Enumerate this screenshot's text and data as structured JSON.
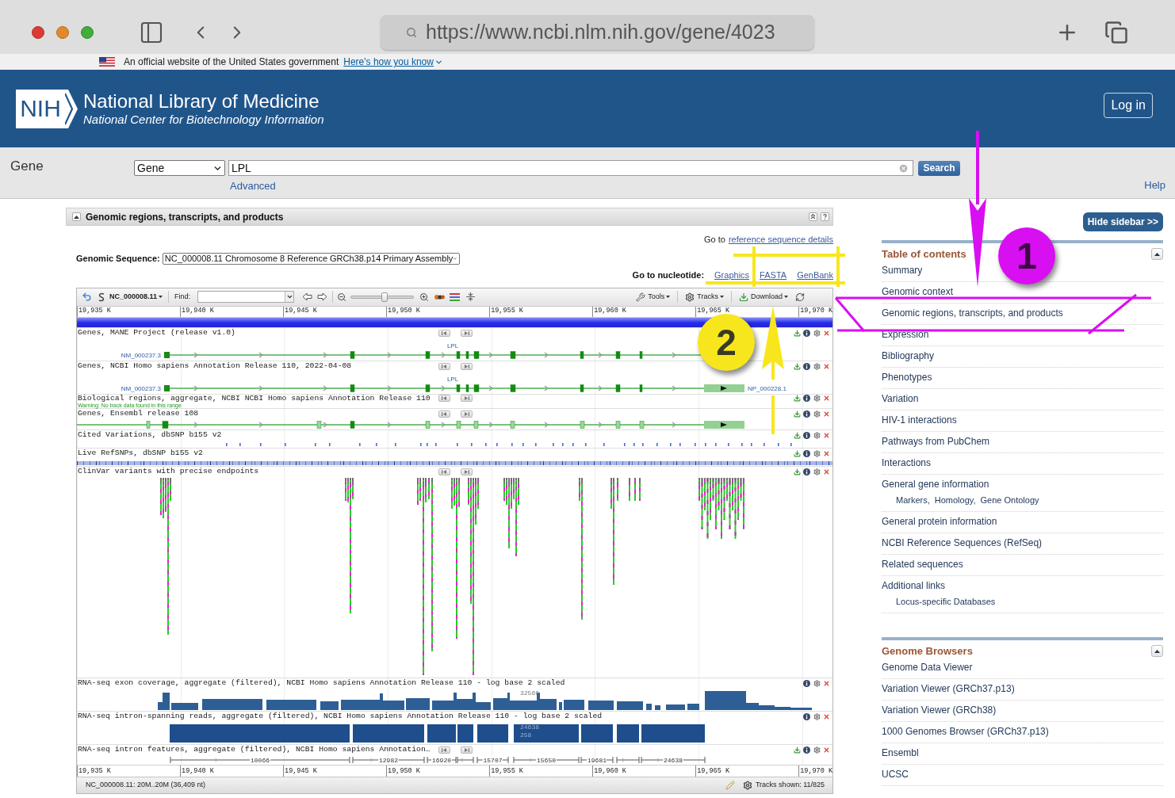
{
  "browser": {
    "url": "https://www.ncbi.nlm.nih.gov/gene/4023"
  },
  "gov_banner": {
    "text": "An official website of the United States government",
    "link": "Here's how you know"
  },
  "header": {
    "logo": "NIH",
    "title": "National Library of Medicine",
    "subtitle": "National Center for Biotechnology Information",
    "login_button": "Log in"
  },
  "search_bar": {
    "database_label": "Gene",
    "database": "Gene",
    "query": "LPL",
    "search_button": "Search",
    "advanced_link": "Advanced",
    "help_link": "Help"
  },
  "section": {
    "title": "Genomic regions, transcripts, and products",
    "expanded": true,
    "reference_prefix": "Go to",
    "reference_link": "reference sequence details",
    "sequence_label": "Genomic Sequence:",
    "sequence": "NC_000008.11 Chromosome 8 Reference GRCh38.p14 Primary Assembly",
    "nucleotide_label": "Go to nucleotide:",
    "nucleotide_links": [
      "Graphics",
      "FASTA",
      "GenBank"
    ],
    "viewer": {
      "toolbar": {
        "sequence": "NC_000008.11",
        "find_label": "Find:",
        "zoom": {
          "level": 0.54
        },
        "menus": [
          {
            "kind": "tools",
            "label": "Tools"
          },
          {
            "kind": "tracks",
            "label": "Tracks"
          },
          {
            "kind": "download",
            "label": "Download"
          }
        ]
      },
      "ruler_top": [
        "19,935 K",
        "19,940 K",
        "19,945 K",
        "19,950 K",
        "19,955 K",
        "19,960 K",
        "19,965 K",
        "19,970 K"
      ],
      "tracks": [
        {
          "kind": "gene",
          "title": "Genes, MANE Project (release v1.0)",
          "gene": "LPL",
          "transcript": "NM_000237.3",
          "navigable": true,
          "downloadable": true
        },
        {
          "kind": "gene",
          "title": "Genes, NCBI Homo sapiens Annotation Release 110, 2022-04-08",
          "gene": "LPL",
          "transcript": "NM_000237.3",
          "protein": "NP_000228.1",
          "navigable": true,
          "downloadable": true
        },
        {
          "kind": "message",
          "title": "Biological regions, aggregate, NCBI NCBI Homo sapiens Annotation Release 110",
          "message": "Warning: No track data found in this range",
          "navigable": true,
          "downloadable": true
        },
        {
          "kind": "gene",
          "title": "Genes, Ensembl release 108",
          "navigable": true,
          "downloadable": true
        },
        {
          "kind": "variants",
          "title": "Cited Variations, dbSNP b155 v2",
          "navigable": false,
          "downloadable": true
        },
        {
          "kind": "snp_density",
          "title": "Live RefSNPs, dbSNP b155 v2",
          "navigable": false,
          "downloadable": true
        },
        {
          "kind": "clinvar",
          "title": "ClinVar variants with precise endpoints",
          "navigable": true,
          "downloadable": true
        },
        {
          "kind": "coverage",
          "title": "RNA-seq exon coverage, aggregate (filtered), NCBI Homo sapiens Annotation Release 110 - log base 2 scaled",
          "labels": [
            "32569"
          ],
          "navigable": false,
          "downloadable": false
        },
        {
          "kind": "reads",
          "title": "RNA-seq intron-spanning reads, aggregate (filtered), NCBI Homo sapiens Annotation Release 110 - log base 2 scaled",
          "labels": [
            "24638",
            "258"
          ],
          "navigable": false,
          "downloadable": false
        },
        {
          "kind": "intron_features",
          "title": "RNA-seq intron features, aggregate (filtered), NCBI Homo sapiens Annotation…",
          "labels": [
            "10066",
            "12982",
            "16920",
            "15707",
            "15650",
            "19681",
            "24638"
          ],
          "navigable": true,
          "downloadable": true
        }
      ],
      "ruler_bottom": [
        "19,935 K",
        "19,940 K",
        "19,945 K",
        "19,950 K",
        "19,955 K",
        "19,960 K",
        "19,965 K",
        "19,970 K"
      ],
      "status": "NC_000008.11: 20M..20M (36,409 nt)",
      "tracks_shown": "Tracks shown: 11/825"
    }
  },
  "sidebar": {
    "hide_button": "Hide sidebar >>",
    "sections": [
      {
        "title": "Table of contents",
        "expanded": true,
        "items": [
          {
            "label": "Summary"
          },
          {
            "label": "Genomic context"
          },
          {
            "label": "Genomic regions, transcripts, and products"
          },
          {
            "label": "Expression"
          },
          {
            "label": "Bibliography"
          },
          {
            "label": "Phenotypes"
          },
          {
            "label": "Variation"
          },
          {
            "label": "HIV-1 interactions"
          },
          {
            "label": "Pathways from PubChem"
          },
          {
            "label": "Interactions"
          },
          {
            "label": "General gene information",
            "sublinks": [
              "Markers,",
              "Homology,",
              "Gene Ontology"
            ]
          },
          {
            "label": "General protein information"
          },
          {
            "label": "NCBI Reference Sequences (RefSeq)"
          },
          {
            "label": "Related sequences"
          },
          {
            "label": "Additional links",
            "sublinks": [
              "Locus-specific Databases"
            ]
          }
        ]
      },
      {
        "title": "Genome Browsers",
        "expanded": true,
        "items": [
          {
            "label": "Genome Data Viewer"
          },
          {
            "label": "Variation Viewer (GRCh37.p13)"
          },
          {
            "label": "Variation Viewer (GRCh38)"
          },
          {
            "label": "1000 Genomes Browser (GRCh37.p13)"
          },
          {
            "label": "Ensembl"
          },
          {
            "label": "UCSC"
          }
        ]
      }
    ]
  },
  "annotations": [
    {
      "label": "1",
      "color": "#d80ff0"
    },
    {
      "label": "2",
      "color": "#f8e61c"
    }
  ]
}
